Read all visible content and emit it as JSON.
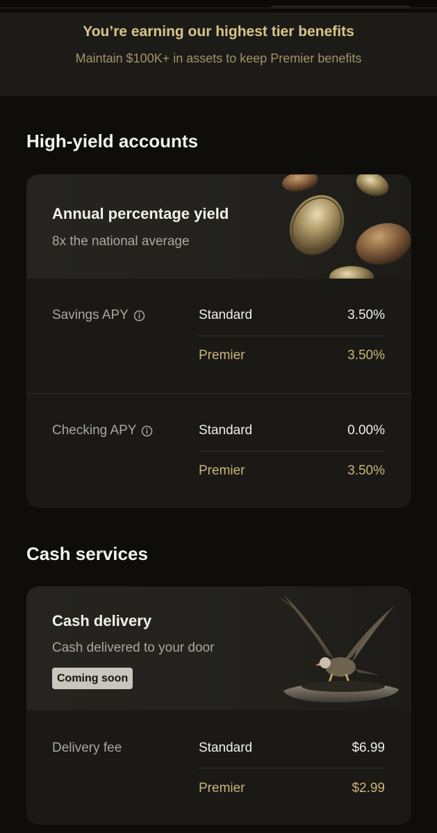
{
  "banner": {
    "title": "You’re earning our highest tier benefits",
    "subtitle": "Maintain $100K+ in assets to keep Premier benefits"
  },
  "high_yield": {
    "section_title": "High-yield accounts",
    "card_title": "Annual percentage yield",
    "card_subtitle": "8x the national average",
    "image_icon": "gold-coins-illustration",
    "rows": [
      {
        "label": "Savings APY",
        "icon": "info-icon",
        "standard_label": "Standard",
        "standard_value": "3.50%",
        "premier_label": "Premier",
        "premier_value": "3.50%"
      },
      {
        "label": "Checking APY",
        "icon": "info-icon",
        "standard_label": "Standard",
        "standard_value": "0.00%",
        "premier_label": "Premier",
        "premier_value": "3.50%"
      }
    ]
  },
  "cash": {
    "section_title": "Cash services",
    "card_title": "Cash delivery",
    "card_subtitle": "Cash delivered to your door",
    "badge": "Coming soon",
    "image_icon": "eagle-on-rock-illustration",
    "rows": [
      {
        "label": "Delivery fee",
        "standard_label": "Standard",
        "standard_value": "$6.99",
        "premier_label": "Premier",
        "premier_value": "$2.99"
      }
    ]
  },
  "colors": {
    "background": "#0e0d0a",
    "card": "#1a1916",
    "gold": "#cbb579",
    "banner_gold": "#d9c48a"
  }
}
